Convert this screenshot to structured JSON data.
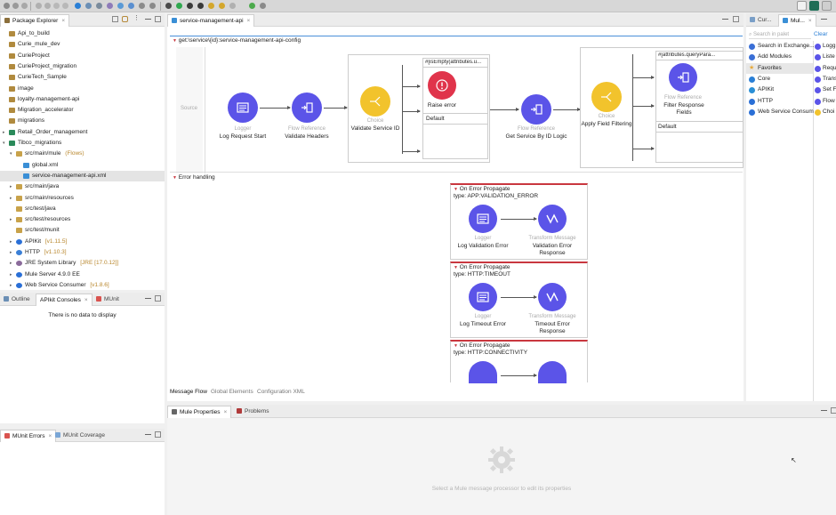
{
  "package_explorer": {
    "tab_label": "Package Explorer",
    "items": [
      {
        "label": "Api_to_build"
      },
      {
        "label": "Curie_mule_dev"
      },
      {
        "label": "CurieProject"
      },
      {
        "label": "CurieProject_migration"
      },
      {
        "label": "CurieTech_Sample"
      },
      {
        "label": "image"
      },
      {
        "label": "loyalty-management-api"
      },
      {
        "label": "Migration_accelerator"
      },
      {
        "label": "migrations"
      },
      {
        "label": "Retail_Order_management"
      },
      {
        "label": "Tibco_migrations"
      },
      {
        "label": "src/main/mule",
        "decoration": "(Flows)"
      },
      {
        "label": "global.xml"
      },
      {
        "label": "service-management-api.xml"
      },
      {
        "label": "src/main/java"
      },
      {
        "label": "src/main/resources"
      },
      {
        "label": "src/test/java"
      },
      {
        "label": "src/test/resources"
      },
      {
        "label": "src/test/munit"
      },
      {
        "label": "APIKit",
        "decoration": "[v1.11.5]"
      },
      {
        "label": "HTTP",
        "decoration": "[v1.10.3]"
      },
      {
        "label": "JRE System Library",
        "decoration": "[JRE [17.0.12]]"
      },
      {
        "label": "Mule Server 4.9.0 EE"
      },
      {
        "label": "Web Service Consumer",
        "decoration": "[v1.8.6]"
      }
    ]
  },
  "outline_panel": {
    "tabs": [
      "Outline",
      "APIkit Consoles",
      "MUnit"
    ],
    "empty_message": "There is no data to display"
  },
  "munit_panel": {
    "tabs": [
      "MUnit Errors",
      "MUnit Coverage"
    ]
  },
  "editor": {
    "tab_label": "service-management-api",
    "flow_header": "get:\\service\\{id}:service-management-api-config",
    "source_label": "Source",
    "processors": [
      {
        "type": "Logger",
        "name": "Log Request Start"
      },
      {
        "type": "Flow Reference",
        "name": "Validate Headers"
      },
      {
        "type": "Choice",
        "name": "Validate Service ID"
      },
      {
        "type": "Flow Reference",
        "name": "Get Service By ID Logic"
      },
      {
        "type": "Choice",
        "name": "Apply Field Filtering"
      }
    ],
    "choice1": {
      "when": "#[isEmpty(attributes.u...",
      "when_processor": "Raise error",
      "default": "Default"
    },
    "choice2": {
      "when": "#[attributes.queryPara...",
      "when_processor_type": "Flow Reference",
      "when_processor": "Filter Response Fields",
      "default": "Default"
    },
    "error_handling_label": "Error handling",
    "error_handlers": [
      {
        "title": "On Error Propagate",
        "type": "type: APP:VALIDATION_ERROR",
        "logger_type": "Logger",
        "logger_name": "Log Validation Error",
        "transform_type": "Transform Message",
        "transform_name": "Validation Error Response"
      },
      {
        "title": "On Error Propagate",
        "type": "type: HTTP:TIMEOUT",
        "logger_type": "Logger",
        "logger_name": "Log Timeout Error",
        "transform_type": "Transform Message",
        "transform_name": "Timeout Error Response"
      },
      {
        "title": "On Error Propagate",
        "type": "type: HTTP:CONNECTIVITY"
      }
    ],
    "bottom_tabs": [
      "Message Flow",
      "Global Elements",
      "Configuration XML"
    ]
  },
  "palette": {
    "tabs": [
      "Cur...",
      "Mul..."
    ],
    "search_placeholder": "Search in palet",
    "clear_label": "Clear",
    "items": [
      {
        "label": "Search in Exchange..."
      },
      {
        "label": "Add Modules"
      },
      {
        "label": "Favorites"
      },
      {
        "label": "Core"
      },
      {
        "label": "APIKit"
      },
      {
        "label": "HTTP"
      },
      {
        "label": "Web Service Consum"
      }
    ],
    "components": [
      "Logg",
      "Liste",
      "Requ",
      "Trans",
      "Set F",
      "Flow",
      "Choi"
    ]
  },
  "properties_panel": {
    "tabs": [
      "Mule Properties",
      "Problems"
    ],
    "empty_message": "Select a Mule message processor to edit its properties"
  },
  "colors": {
    "processor_purple": "#5b54e8",
    "choice_yellow": "#f2c32c",
    "raise_error_red": "#e0344b",
    "error_border": "#c9373f"
  }
}
